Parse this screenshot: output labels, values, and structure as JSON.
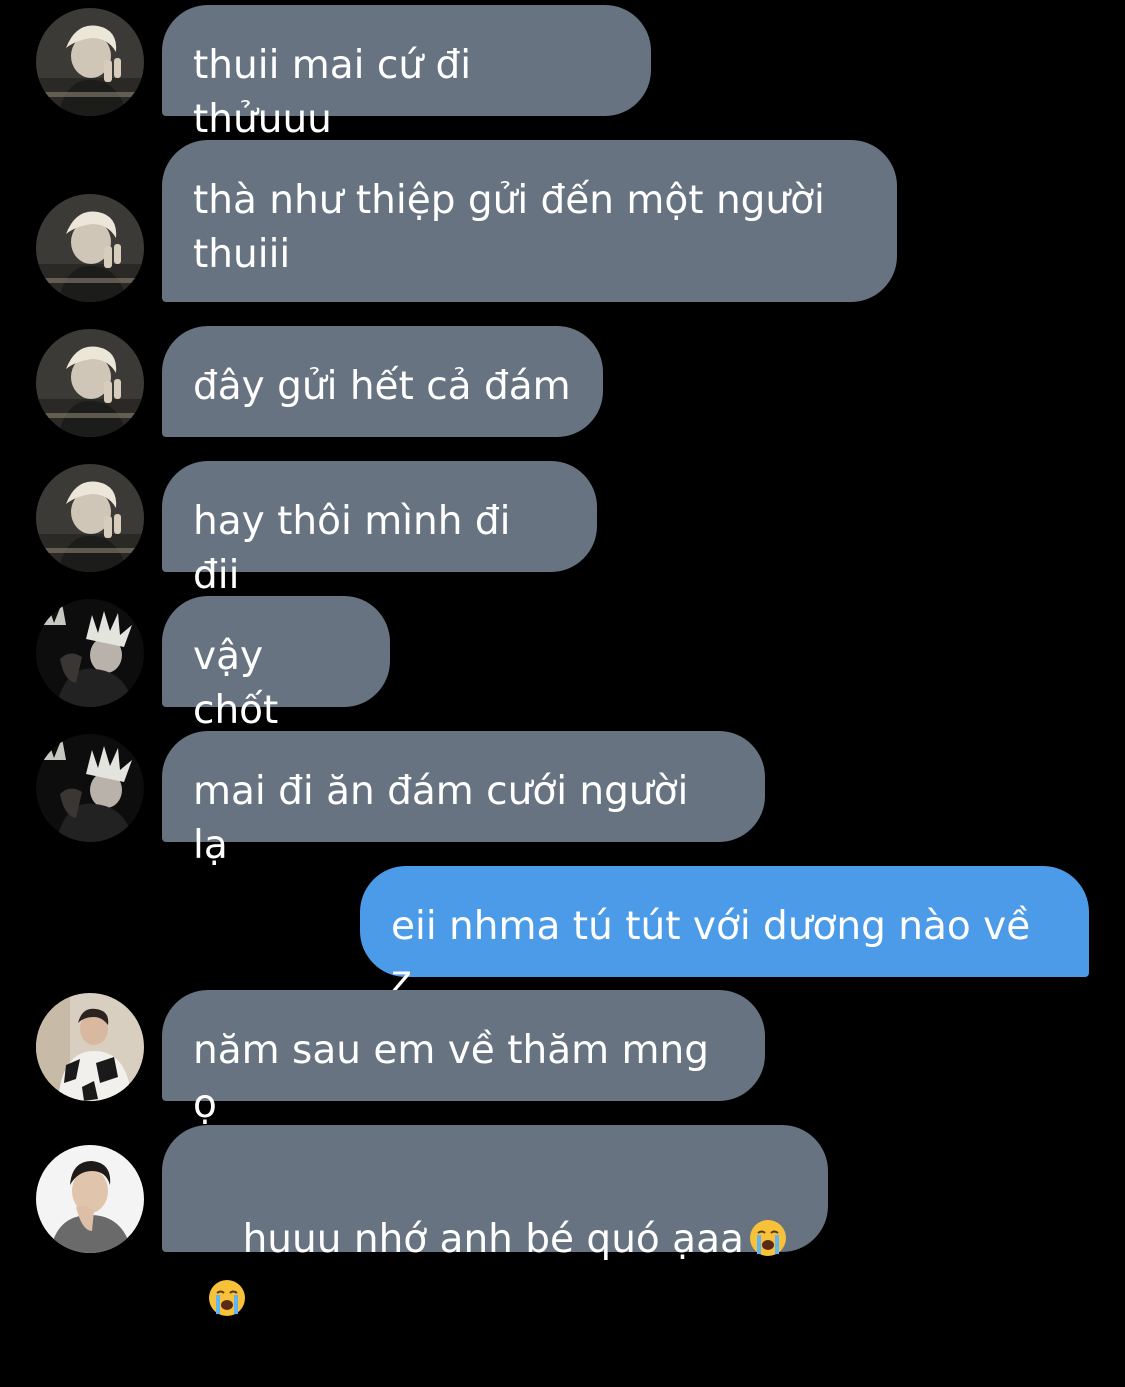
{
  "colors": {
    "background": "#000000",
    "incoming_bubble": "#677381",
    "outgoing_bubble": "#4c9be8",
    "text": "#ffffff"
  },
  "messages": [
    {
      "sender": "incoming",
      "avatar": "avatar-blond-peace-sign",
      "text": "thuii mai cứ đi thửuuu"
    },
    {
      "sender": "incoming",
      "avatar": "avatar-blond-peace-sign",
      "text": "thà như thiệp gửi đến một người\nthuiii"
    },
    {
      "sender": "incoming",
      "avatar": "avatar-blond-peace-sign",
      "text": "đây gửi hết cả đám"
    },
    {
      "sender": "incoming",
      "avatar": "avatar-blond-peace-sign",
      "text": "hay thôi mình đi đii"
    },
    {
      "sender": "incoming",
      "avatar": "avatar-spiky-hair-dark",
      "text": "vậy chốt"
    },
    {
      "sender": "incoming",
      "avatar": "avatar-spiky-hair-dark",
      "text": "mai đi ăn đám cưới người lạ"
    },
    {
      "sender": "outgoing",
      "avatar": "",
      "text": "eii nhma tú tút với dương nào về z"
    },
    {
      "sender": "incoming",
      "avatar": "avatar-patterned-sweater",
      "text": "năm sau em về thăm mng ọ"
    },
    {
      "sender": "incoming",
      "avatar": "avatar-hand-on-chin",
      "text": "huuu nhớ anh bé quó ạaa",
      "emojis": [
        "crying-face-emoji",
        "crying-face-emoji"
      ]
    }
  ]
}
